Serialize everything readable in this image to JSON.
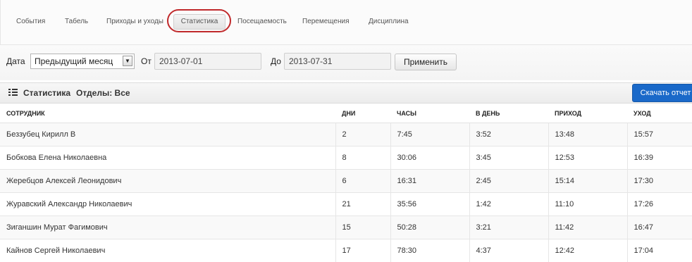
{
  "tabs": [
    {
      "label": "События"
    },
    {
      "label": "Табель"
    },
    {
      "label": "Приходы и уходы"
    },
    {
      "label": "Статистика",
      "active": true
    },
    {
      "label": "Посещаемость"
    },
    {
      "label": "Перемещения"
    },
    {
      "label": "Дисциплина"
    }
  ],
  "filters": {
    "date_label": "Дата",
    "period_value": "Предыдущий месяц",
    "from_label": "От",
    "from_value": "2013-07-01",
    "to_label": "До",
    "to_value": "2013-07-31",
    "apply_label": "Применить"
  },
  "panel": {
    "icon": "list-icon",
    "title": "Статистика",
    "subtitle": "Отделы: Все",
    "download_label": "Скачать отчет",
    "accent_color": "#1a69c9"
  },
  "table": {
    "columns": [
      "СОТРУДНИК",
      "ДНИ",
      "ЧАСЫ",
      "В ДЕНЬ",
      "ПРИХОД",
      "УХОД"
    ],
    "rows": [
      [
        "Беззубец Кирилл В",
        "2",
        "7:45",
        "3:52",
        "13:48",
        "15:57"
      ],
      [
        "Бобкова Елена Николаевна",
        "8",
        "30:06",
        "3:45",
        "12:53",
        "16:39"
      ],
      [
        "Жеребцов Алексей Леонидович",
        "6",
        "16:31",
        "2:45",
        "15:14",
        "17:30"
      ],
      [
        "Журавский Александр Николаевич",
        "21",
        "35:56",
        "1:42",
        "11:10",
        "17:26"
      ],
      [
        "Зиганшин Мурат Фагимович",
        "15",
        "50:28",
        "3:21",
        "11:42",
        "16:47"
      ],
      [
        "Кайнов Сергей Николаевич",
        "17",
        "78:30",
        "4:37",
        "12:42",
        "17:04"
      ]
    ]
  }
}
